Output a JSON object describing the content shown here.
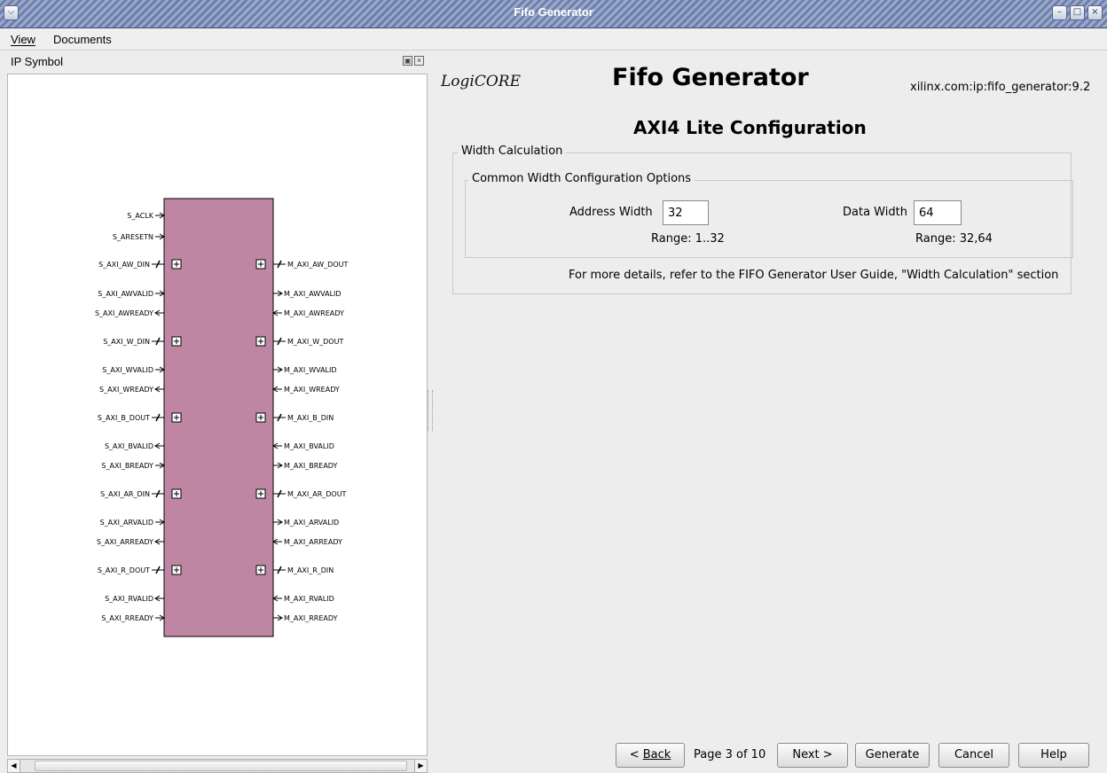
{
  "window": {
    "title": "Fifo Generator"
  },
  "menu": {
    "items": [
      "View",
      "Documents"
    ]
  },
  "left_panel": {
    "title": "IP Symbol",
    "left_ports": [
      {
        "label": "S_ACLK",
        "dir": "in",
        "bus": false
      },
      {
        "label": "S_ARESETN",
        "dir": "in",
        "bus": false
      },
      {
        "label": "S_AXI_AW_DIN",
        "dir": "in",
        "bus": true
      },
      {
        "label": "S_AXI_AWVALID",
        "dir": "in",
        "bus": false
      },
      {
        "label": "S_AXI_AWREADY",
        "dir": "out",
        "bus": false
      },
      {
        "label": "S_AXI_W_DIN",
        "dir": "in",
        "bus": true
      },
      {
        "label": "S_AXI_WVALID",
        "dir": "in",
        "bus": false
      },
      {
        "label": "S_AXI_WREADY",
        "dir": "out",
        "bus": false
      },
      {
        "label": "S_AXI_B_DOUT",
        "dir": "out",
        "bus": true
      },
      {
        "label": "S_AXI_BVALID",
        "dir": "out",
        "bus": false
      },
      {
        "label": "S_AXI_BREADY",
        "dir": "in",
        "bus": false
      },
      {
        "label": "S_AXI_AR_DIN",
        "dir": "in",
        "bus": true
      },
      {
        "label": "S_AXI_ARVALID",
        "dir": "in",
        "bus": false
      },
      {
        "label": "S_AXI_ARREADY",
        "dir": "out",
        "bus": false
      },
      {
        "label": "S_AXI_R_DOUT",
        "dir": "out",
        "bus": true
      },
      {
        "label": "S_AXI_RVALID",
        "dir": "out",
        "bus": false
      },
      {
        "label": "S_AXI_RREADY",
        "dir": "in",
        "bus": false
      }
    ],
    "right_ports": [
      {
        "label": "M_AXI_AW_DOUT",
        "dir": "out",
        "bus": true
      },
      {
        "label": "M_AXI_AWVALID",
        "dir": "out",
        "bus": false
      },
      {
        "label": "M_AXI_AWREADY",
        "dir": "in",
        "bus": false
      },
      {
        "label": "M_AXI_W_DOUT",
        "dir": "out",
        "bus": true
      },
      {
        "label": "M_AXI_WVALID",
        "dir": "out",
        "bus": false
      },
      {
        "label": "M_AXI_WREADY",
        "dir": "in",
        "bus": false
      },
      {
        "label": "M_AXI_B_DIN",
        "dir": "in",
        "bus": true
      },
      {
        "label": "M_AXI_BVALID",
        "dir": "in",
        "bus": false
      },
      {
        "label": "M_AXI_BREADY",
        "dir": "out",
        "bus": false
      },
      {
        "label": "M_AXI_AR_DOUT",
        "dir": "out",
        "bus": true
      },
      {
        "label": "M_AXI_ARVALID",
        "dir": "out",
        "bus": false
      },
      {
        "label": "M_AXI_ARREADY",
        "dir": "in",
        "bus": false
      },
      {
        "label": "M_AXI_R_DIN",
        "dir": "in",
        "bus": true
      },
      {
        "label": "M_AXI_RVALID",
        "dir": "in",
        "bus": false
      },
      {
        "label": "M_AXI_RREADY",
        "dir": "out",
        "bus": false
      }
    ]
  },
  "header": {
    "logo": "LogiCORE",
    "title": "Fifo Generator",
    "ip_id": "xilinx.com:ip:fifo_generator:9.2",
    "page_title": "AXI4 Lite Configuration"
  },
  "width_calc": {
    "group_label": "Width Calculation",
    "options_label": "Common Width Configuration Options",
    "address_label": "Address Width",
    "address_value": "32",
    "address_range": "Range: 1..32",
    "data_label": "Data Width",
    "data_value": "64",
    "data_range": "Range: 32,64",
    "note": "For more details, refer to the FIFO Generator User Guide, \"Width Calculation\" section"
  },
  "footer": {
    "back_label": "Back",
    "page_indicator": "Page 3 of 10",
    "next_label": "Next >",
    "generate_label": "Generate",
    "cancel_label": "Cancel",
    "help_label": "Help"
  }
}
